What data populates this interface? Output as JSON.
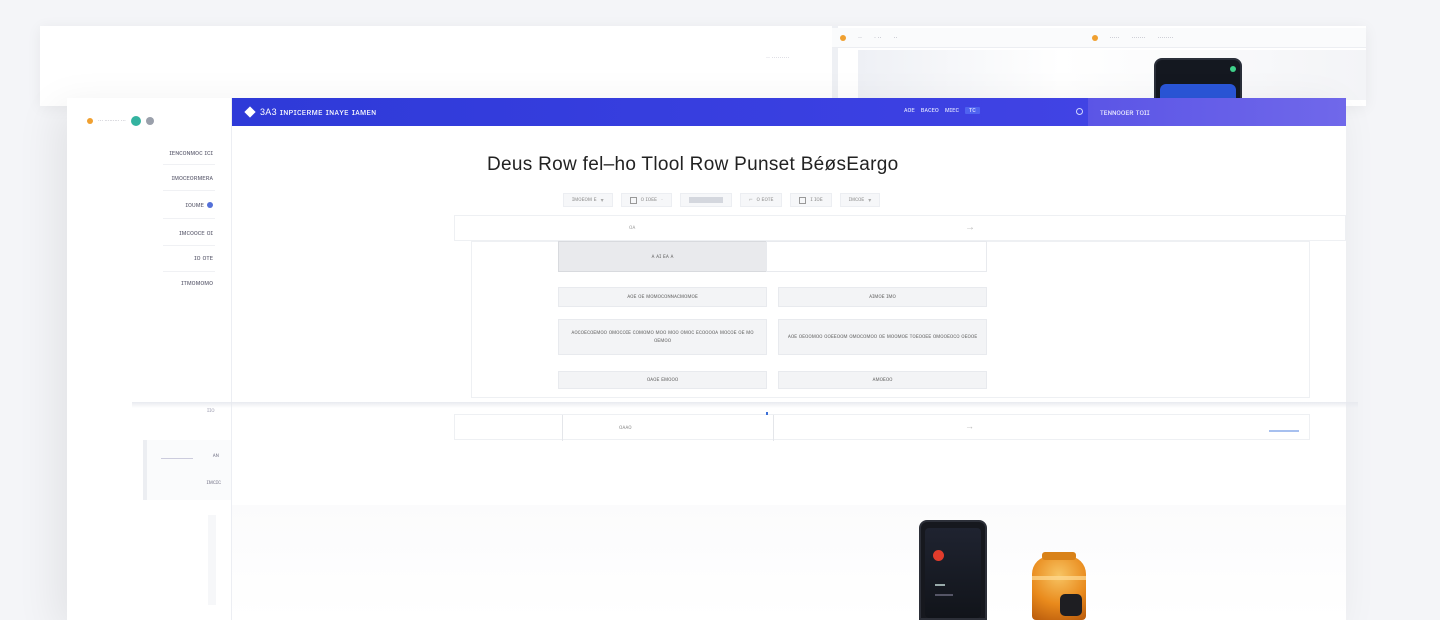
{
  "background": {
    "top_left_note": "·· ·········",
    "top_links": [
      "··",
      "·  ··",
      "··",
      "·····",
      "·······",
      "········"
    ]
  },
  "app": {
    "brand": "3A3 ɪɴᴘɪᴄᴇʀᴍᴇ ɪɴᴀʏᴇ ɪᴀᴍᴇɴ",
    "top_links": [
      "ᴀᴏᴇ",
      "ʙᴀᴄᴇᴏ",
      "ᴍɪᴇᴄ",
      "ᴛᴄ"
    ],
    "top_right_label": "ᴛᴇɴɴᴏᴏᴇʀ ᴛᴏɪɪ",
    "colors": {
      "topbar": "#2e3ad8",
      "accent": "#4f63f0",
      "avatar": "#34b3a0"
    }
  },
  "sidebar": {
    "header_text": "··· ········· ···",
    "items": [
      {
        "label": "ɪᴇɴᴄᴏɴᴍᴏᴄ ɪᴄɪ"
      },
      {
        "label": "ɪᴍᴏᴄᴇᴏʀᴍᴇʀᴀ"
      },
      {
        "label": "ɪᴏᴜᴍᴇ"
      },
      {
        "label": "ɪᴍᴄᴏᴏᴄᴇ ᴏɪ"
      },
      {
        "label": "ɪᴏ ᴏᴛᴇ"
      },
      {
        "label": "ɪᴛᴍᴏᴍᴏᴍᴏ"
      }
    ],
    "small_label": "ɪɪᴏ",
    "bottom_value_1": "ᴀɴ",
    "bottom_value_2": "ɪᴍᴄɪᴄ"
  },
  "main": {
    "page_title": "Deus Row fel–ho Tlool Row Punset BéøsEargo",
    "toolbar": [
      {
        "label": "ɪᴍᴏᴇᴏᴍ ᴇ",
        "icon": "chevron-down-icon"
      },
      {
        "label": "ᴏ ɪᴏᴇᴇ",
        "icon": "checkbox-icon"
      },
      {
        "label": "",
        "icon": "bar-icon"
      },
      {
        "label": "ᴏ ᴇᴏᴛᴇ",
        "icon": "toggle-icon"
      },
      {
        "label": "ɪ ɪᴏᴇ",
        "icon": "box-icon"
      },
      {
        "label": "ɪᴍᴄᴏᴇ",
        "icon": "chevron-down-icon"
      }
    ],
    "row_header_label": "ᴏᴀ",
    "grid": {
      "top_cell": "ᴀ  ᴀɪ  ᴇᴀ  ᴀ",
      "row1_left": "ᴀᴏᴇ ᴏᴇ ᴍᴏᴍᴏᴄᴏɴɴᴀᴄᴍᴏᴍᴏᴇ",
      "row1_right": "ᴀɪᴍᴏᴇ ɪᴍᴏ",
      "row2_left": "ᴀᴏᴄᴏᴇᴄᴏᴇᴍᴏᴏ ᴏᴍᴏᴄᴏɪᴇ ᴄᴏᴍᴏᴍᴏ ᴍᴏᴏ ᴍᴏᴏ ᴏᴍᴏᴄ ᴇᴄᴏᴏᴏᴏᴀ ᴍᴏᴄᴏᴇ ᴏᴇ ᴍᴏ ᴏᴇᴍᴏᴏ",
      "row2_right": "ᴀᴏᴇ ᴏᴇᴏᴏᴍᴏᴏ ᴏᴏᴇᴇᴏᴏᴍ ᴏᴍᴏᴄᴏᴍᴏᴏ ᴏᴇ ᴍᴏᴏᴍᴏᴇ ᴛᴏᴇᴏᴏᴇᴇ ᴏᴍᴏᴏᴇᴏᴄᴏ ᴏᴇᴏᴏᴇ",
      "row3_left": "ᴏᴀᴏᴇ ᴇᴍᴏᴏᴏ",
      "row3_right": "ᴀᴍᴏᴇᴏᴏ"
    },
    "bottom_input_value": "ᴏᴀᴀᴏ"
  }
}
